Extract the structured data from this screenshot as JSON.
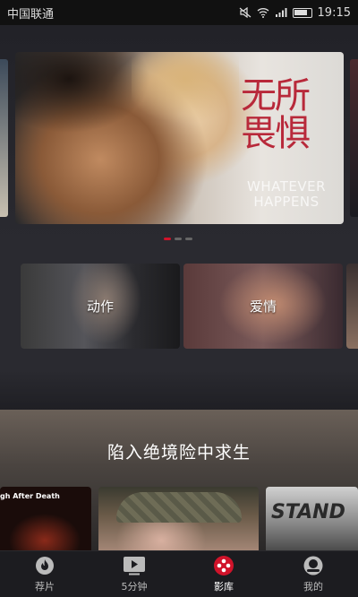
{
  "status": {
    "carrier": "中国联通",
    "time": "19:15"
  },
  "hero": {
    "title_cn_line1": "无所",
    "title_cn_line2": "畏惧",
    "title_en_line1": "WHATEVER",
    "title_en_line2": "HAPPENS",
    "slides": 3,
    "active_slide": 1
  },
  "genres": [
    {
      "label": "动作"
    },
    {
      "label": "爱情"
    }
  ],
  "feature": {
    "title": "陷入绝境险中求生",
    "posters": [
      {
        "text": "gh After Death"
      },
      {
        "text": ""
      },
      {
        "text": "STAND"
      }
    ]
  },
  "tabs": [
    {
      "label": "荐片",
      "icon": "flame-icon"
    },
    {
      "label": "5分钟",
      "icon": "play-screen-icon"
    },
    {
      "label": "影库",
      "icon": "film-reel-icon"
    },
    {
      "label": "我的",
      "icon": "profile-icon"
    }
  ],
  "colors": {
    "accent": "#d0132a",
    "hero_title": "#b8293a"
  }
}
